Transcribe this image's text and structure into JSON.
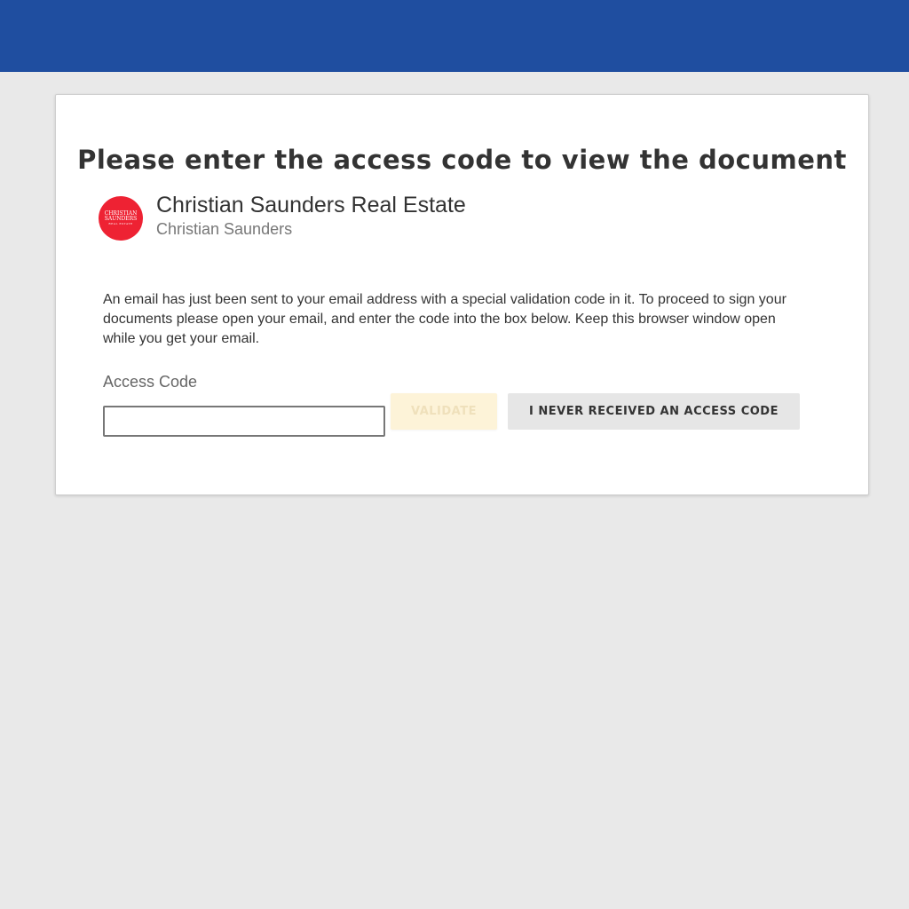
{
  "page": {
    "title": "Please enter the access code to view the document"
  },
  "company": {
    "name": "Christian Saunders Real Estate",
    "contact": "Christian Saunders",
    "logo_line1": "CHRISTIAN",
    "logo_line2": "SAUNDERS",
    "logo_line3": "REAL ESTATE"
  },
  "message": "An email has just been sent to your email address with a special validation code in it. To proceed to sign your documents please open your email, and enter the code into the box below. Keep this browser window open while you get your email.",
  "form": {
    "access_code_label": "Access Code",
    "access_code_value": "",
    "validate_label": "VALIDATE",
    "never_received_label": "I NEVER RECEIVED AN ACCESS CODE"
  },
  "colors": {
    "header": "#1f4ea0",
    "background": "#e9e9e9",
    "logo": "#ee2233",
    "validate_bg": "#fdf3d8",
    "secondary_button_bg": "#e6e6e6"
  }
}
